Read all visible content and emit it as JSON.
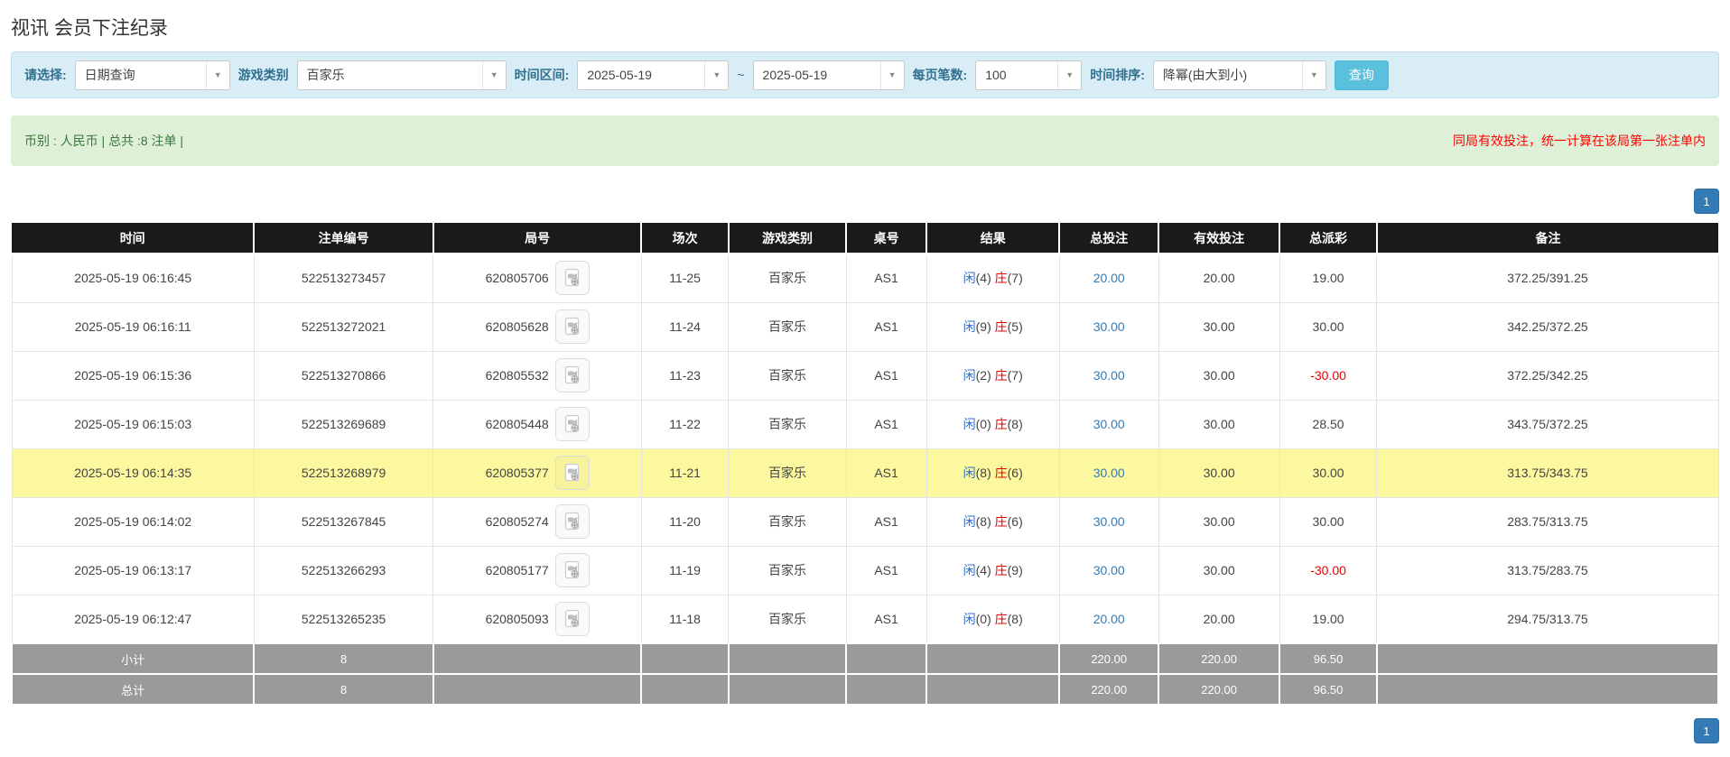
{
  "page": {
    "title": "视讯 会员下注纪录"
  },
  "filters": {
    "select_label": "请选择:",
    "select_value": "日期查询",
    "game_type_label": "游戏类别",
    "game_type_value": "百家乐",
    "time_range_label": "时间区间:",
    "date_from": "2025-05-19",
    "date_separator": "~",
    "date_to": "2025-05-19",
    "page_size_label": "每页笔数:",
    "page_size_value": "100",
    "sort_label": "时间排序:",
    "sort_value": "降幂(由大到小)",
    "search_button_label": "查询"
  },
  "summary": {
    "left_text": "币别 : 人民币 | 总共 :8 注单 |",
    "right_text": "同局有效投注，统一计算在该局第一张注单内"
  },
  "pagination": {
    "page_label": "1"
  },
  "colors": {
    "accent_blue": "#337ab7",
    "button_blue": "#5bc0de",
    "player_blue": "#2e6ec9",
    "banker_red": "#e60000",
    "highlight_yellow": "#fbf8a0",
    "header_black": "#1a1a1a",
    "footer_grey": "#9a9a9a",
    "filter_bg": "#d9edf7",
    "summary_bg": "#dff0d8"
  },
  "icons": {
    "combo_arrow": "▼",
    "video_replay": "video-file-icon"
  },
  "table": {
    "headers": [
      "时间",
      "注单编号",
      "局号",
      "场次",
      "游戏类别",
      "桌号",
      "结果",
      "总投注",
      "有效投注",
      "总派彩",
      "备注"
    ],
    "result_labels": {
      "player": "闲",
      "banker": "庄"
    },
    "rows": [
      {
        "time": "2025-05-19 06:16:45",
        "bet_id": "522513273457",
        "round_id": "620805706",
        "session": "11-25",
        "game": "百家乐",
        "table_no": "AS1",
        "player": "4",
        "banker": "7",
        "total_bet": "20.00",
        "valid_bet": "20.00",
        "payout": "19.00",
        "remark": "372.25/391.25",
        "highlight": false
      },
      {
        "time": "2025-05-19 06:16:11",
        "bet_id": "522513272021",
        "round_id": "620805628",
        "session": "11-24",
        "game": "百家乐",
        "table_no": "AS1",
        "player": "9",
        "banker": "5",
        "total_bet": "30.00",
        "valid_bet": "30.00",
        "payout": "30.00",
        "remark": "342.25/372.25",
        "highlight": false
      },
      {
        "time": "2025-05-19 06:15:36",
        "bet_id": "522513270866",
        "round_id": "620805532",
        "session": "11-23",
        "game": "百家乐",
        "table_no": "AS1",
        "player": "2",
        "banker": "7",
        "total_bet": "30.00",
        "valid_bet": "30.00",
        "payout": "-30.00",
        "remark": "372.25/342.25",
        "highlight": false
      },
      {
        "time": "2025-05-19 06:15:03",
        "bet_id": "522513269689",
        "round_id": "620805448",
        "session": "11-22",
        "game": "百家乐",
        "table_no": "AS1",
        "player": "0",
        "banker": "8",
        "total_bet": "30.00",
        "valid_bet": "30.00",
        "payout": "28.50",
        "remark": "343.75/372.25",
        "highlight": false
      },
      {
        "time": "2025-05-19 06:14:35",
        "bet_id": "522513268979",
        "round_id": "620805377",
        "session": "11-21",
        "game": "百家乐",
        "table_no": "AS1",
        "player": "8",
        "banker": "6",
        "total_bet": "30.00",
        "valid_bet": "30.00",
        "payout": "30.00",
        "remark": "313.75/343.75",
        "highlight": true
      },
      {
        "time": "2025-05-19 06:14:02",
        "bet_id": "522513267845",
        "round_id": "620805274",
        "session": "11-20",
        "game": "百家乐",
        "table_no": "AS1",
        "player": "8",
        "banker": "6",
        "total_bet": "30.00",
        "valid_bet": "30.00",
        "payout": "30.00",
        "remark": "283.75/313.75",
        "highlight": false
      },
      {
        "time": "2025-05-19 06:13:17",
        "bet_id": "522513266293",
        "round_id": "620805177",
        "session": "11-19",
        "game": "百家乐",
        "table_no": "AS1",
        "player": "4",
        "banker": "9",
        "total_bet": "30.00",
        "valid_bet": "30.00",
        "payout": "-30.00",
        "remark": "313.75/283.75",
        "highlight": false
      },
      {
        "time": "2025-05-19 06:12:47",
        "bet_id": "522513265235",
        "round_id": "620805093",
        "session": "11-18",
        "game": "百家乐",
        "table_no": "AS1",
        "player": "0",
        "banker": "8",
        "total_bet": "20.00",
        "valid_bet": "20.00",
        "payout": "19.00",
        "remark": "294.75/313.75",
        "highlight": false
      }
    ],
    "footer": [
      {
        "label": "小计",
        "count": "8",
        "total_bet": "220.00",
        "valid_bet": "220.00",
        "payout": "96.50"
      },
      {
        "label": "总计",
        "count": "8",
        "total_bet": "220.00",
        "valid_bet": "220.00",
        "payout": "96.50"
      }
    ]
  }
}
